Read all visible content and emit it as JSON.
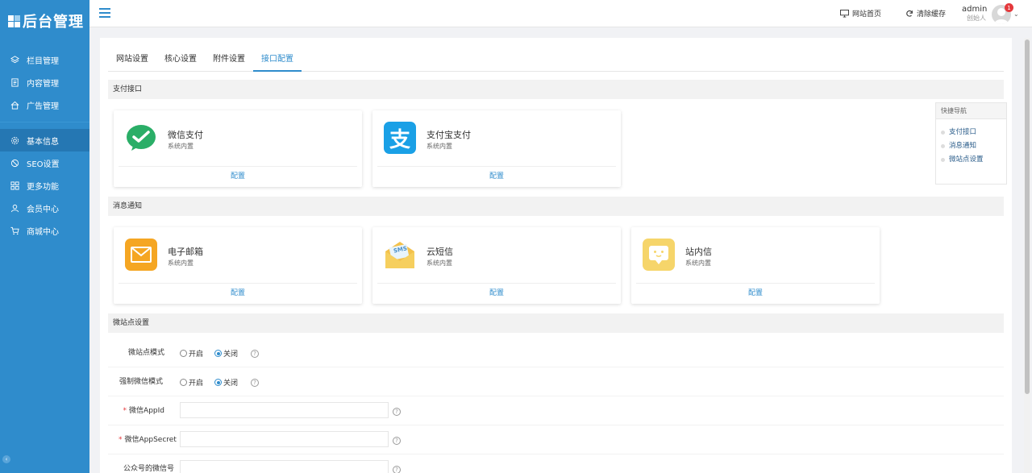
{
  "sidebar": {
    "logo_text": "后台管理",
    "items": [
      {
        "label": "栏目管理",
        "icon": "layers-icon"
      },
      {
        "label": "内容管理",
        "icon": "document-icon"
      },
      {
        "label": "广告管理",
        "icon": "home-icon"
      },
      {
        "label": "基本信息",
        "icon": "gear-icon"
      },
      {
        "label": "SEO设置",
        "icon": "ban-icon"
      },
      {
        "label": "更多功能",
        "icon": "grid-icon"
      },
      {
        "label": "会员中心",
        "icon": "user-icon"
      },
      {
        "label": "商城中心",
        "icon": "cart-icon"
      }
    ],
    "collapse_glyph": "‹"
  },
  "header": {
    "site_home": "网站首页",
    "clear_cache": "清除缓存",
    "user_name": "admin",
    "user_role": "创始人",
    "badge_count": "1",
    "caret": "⌄"
  },
  "tabs": [
    {
      "label": "网站设置"
    },
    {
      "label": "核心设置"
    },
    {
      "label": "附件设置"
    },
    {
      "label": "接口配置",
      "active": true
    }
  ],
  "sections": {
    "payment": "支付接口",
    "notify": "消息通知",
    "microsite": "微站点设置"
  },
  "cards": {
    "wechat_pay": {
      "title": "微信支付",
      "sub": "系统内置",
      "action": "配置"
    },
    "alipay": {
      "title": "支付宝支付",
      "sub": "系统内置",
      "action": "配置"
    },
    "email": {
      "title": "电子邮箱",
      "sub": "系统内置",
      "action": "配置"
    },
    "sms": {
      "title": "云短信",
      "sub": "系统内置",
      "action": "配置",
      "icon_text": "SMS"
    },
    "inmail": {
      "title": "站内信",
      "sub": "系统内置",
      "action": "配置"
    }
  },
  "alipay_glyph": "支",
  "quicknav": {
    "title": "快捷导航",
    "items": [
      {
        "label": "支付接口"
      },
      {
        "label": "消息通知"
      },
      {
        "label": "微站点设置"
      }
    ]
  },
  "form": {
    "micro_mode": {
      "label": "微站点模式",
      "on": "开启",
      "off": "关闭"
    },
    "force_wechat": {
      "label": "强制微信模式",
      "on": "开启",
      "off": "关闭"
    },
    "appid": {
      "label": "微信AppId",
      "value": ""
    },
    "appsecret": {
      "label": "微信AppSecret",
      "value": ""
    },
    "mp_account": {
      "label": "公众号的微信号",
      "value": ""
    },
    "required_mark": "*",
    "help_glyph": "?"
  },
  "colors": {
    "sidebar": "#2f8ccc",
    "accent": "#2f8ccc",
    "wechat": "#2aae67",
    "alipay": "#1aa0e6",
    "email": "#f5a623",
    "sms": "#f3c14b",
    "inmail": "#f6d56a"
  }
}
